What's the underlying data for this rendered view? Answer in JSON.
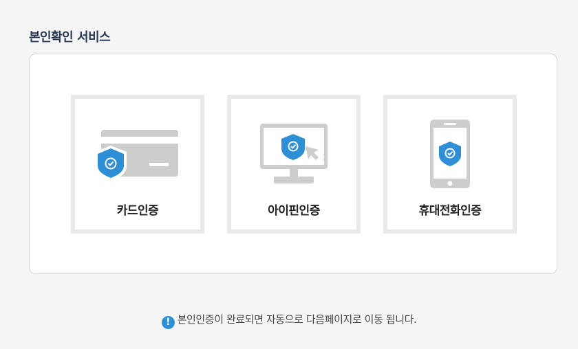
{
  "page": {
    "title": "본인확인 서비스"
  },
  "options": [
    {
      "label": "카드인증",
      "icon": "credit-card-shield-icon"
    },
    {
      "label": "아이핀인증",
      "icon": "monitor-shield-cursor-icon"
    },
    {
      "label": "휴대전화인증",
      "icon": "mobile-phone-shield-icon"
    }
  ],
  "notice": {
    "icon": "info-icon",
    "text": "본인인증이 완료되면 자동으로 다음페이지로 이동 됩니다."
  },
  "colors": {
    "accent": "#2f8fd6",
    "icon_gray": "#cdcdcd",
    "card_border": "#eaeaea",
    "title": "#2a3a55"
  }
}
